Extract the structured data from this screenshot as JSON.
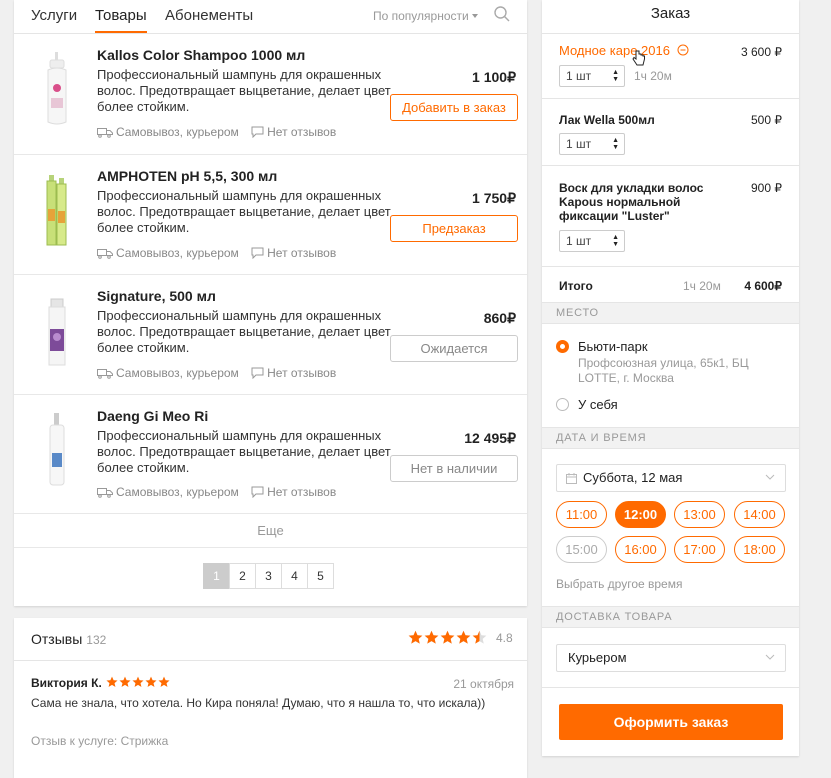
{
  "tabs": {
    "services": "Услуги",
    "products": "Товары",
    "subscriptions": "Абонементы"
  },
  "sort_label": "По популярности",
  "products": [
    {
      "name": "Kallos Color Shampoo 1000 мл",
      "desc": "Профессиональный шампунь для окрашенных волос. Предотвращает выцветание, делает цвет более стойким.",
      "price": "1 100₽",
      "button": "Добавить в заказ",
      "delivery": "Самовывоз, курьером",
      "reviews": "Нет отзывов"
    },
    {
      "name": "AMPHOTEN pH 5,5, 300 мл",
      "desc": "Профессиональный шампунь для окрашенных волос. Предотвращает выцветание, делает цвет более стойким.",
      "price": "1 750₽",
      "button": "Предзаказ",
      "delivery": "Самовывоз, курьером",
      "reviews": "Нет отзывов"
    },
    {
      "name": "Signature, 500 мл",
      "desc": "Профессиональный шампунь для окрашенных волос. Предотвращает выцветание, делает цвет более стойким.",
      "price": "860₽",
      "button": "Ожидается",
      "delivery": "Самовывоз, курьером",
      "reviews": "Нет отзывов"
    },
    {
      "name": "Daeng Gi Meo Ri",
      "desc": "Профессиональный шампунь для окрашенных волос. Предотвращает выцветание, делает цвет более стойким.",
      "price": "12 495₽",
      "button": "Нет в наличии",
      "delivery": "Самовывоз, курьером",
      "reviews": "Нет отзывов"
    }
  ],
  "more_label": "Еще",
  "pages": [
    "1",
    "2",
    "3",
    "4",
    "5"
  ],
  "current_page": "1",
  "reviews": {
    "title": "Отзывы",
    "count": "132",
    "rating": "4.8",
    "rating_value": 4.5,
    "items": [
      {
        "author": "Виктория К.",
        "stars": 5,
        "date": "21 октября",
        "text": "Сама не знала, что хотела. Но Кира поняла! Думаю, что я нашла то, что искала))",
        "service": "Отзыв к услуге: Стрижка"
      }
    ]
  },
  "order": {
    "title": "Заказ",
    "items": [
      {
        "name": "Модное каре 2016",
        "price": "3 600 ₽",
        "qty": "1 шт",
        "duration": "1ч 20м"
      },
      {
        "name": "Лак Wella 500мл",
        "price": "500 ₽",
        "qty": "1 шт"
      },
      {
        "name": "Воск для укладки волос Kapous нормальной фиксации \"Luster\"",
        "price": "900 ₽",
        "qty": "1 шт"
      }
    ],
    "total_label": "Итого",
    "total_duration": "1ч 20м",
    "total_price": "4 600₽",
    "place_section": "МЕСТО",
    "places": [
      {
        "name": "Бьюти-парк",
        "address": "Профсоюзная улица, 65к1, БЦ LOTTE, г. Москва",
        "selected": true
      },
      {
        "name": "У себя",
        "selected": false
      }
    ],
    "datetime_section": "ДАТА И ВРЕМЯ",
    "date_value": "Суббота, 12 мая",
    "times": [
      "11:00",
      "12:00",
      "13:00",
      "14:00",
      "15:00",
      "16:00",
      "17:00",
      "18:00"
    ],
    "selected_time": "12:00",
    "disabled_time": "15:00",
    "other_time": "Выбрать другое время",
    "delivery_section": "ДОСТАВКА ТОВАРА",
    "delivery_value": "Курьером",
    "submit": "Оформить заказ"
  },
  "colors": {
    "accent": "#ff6a00",
    "star": "#ff6a00"
  }
}
